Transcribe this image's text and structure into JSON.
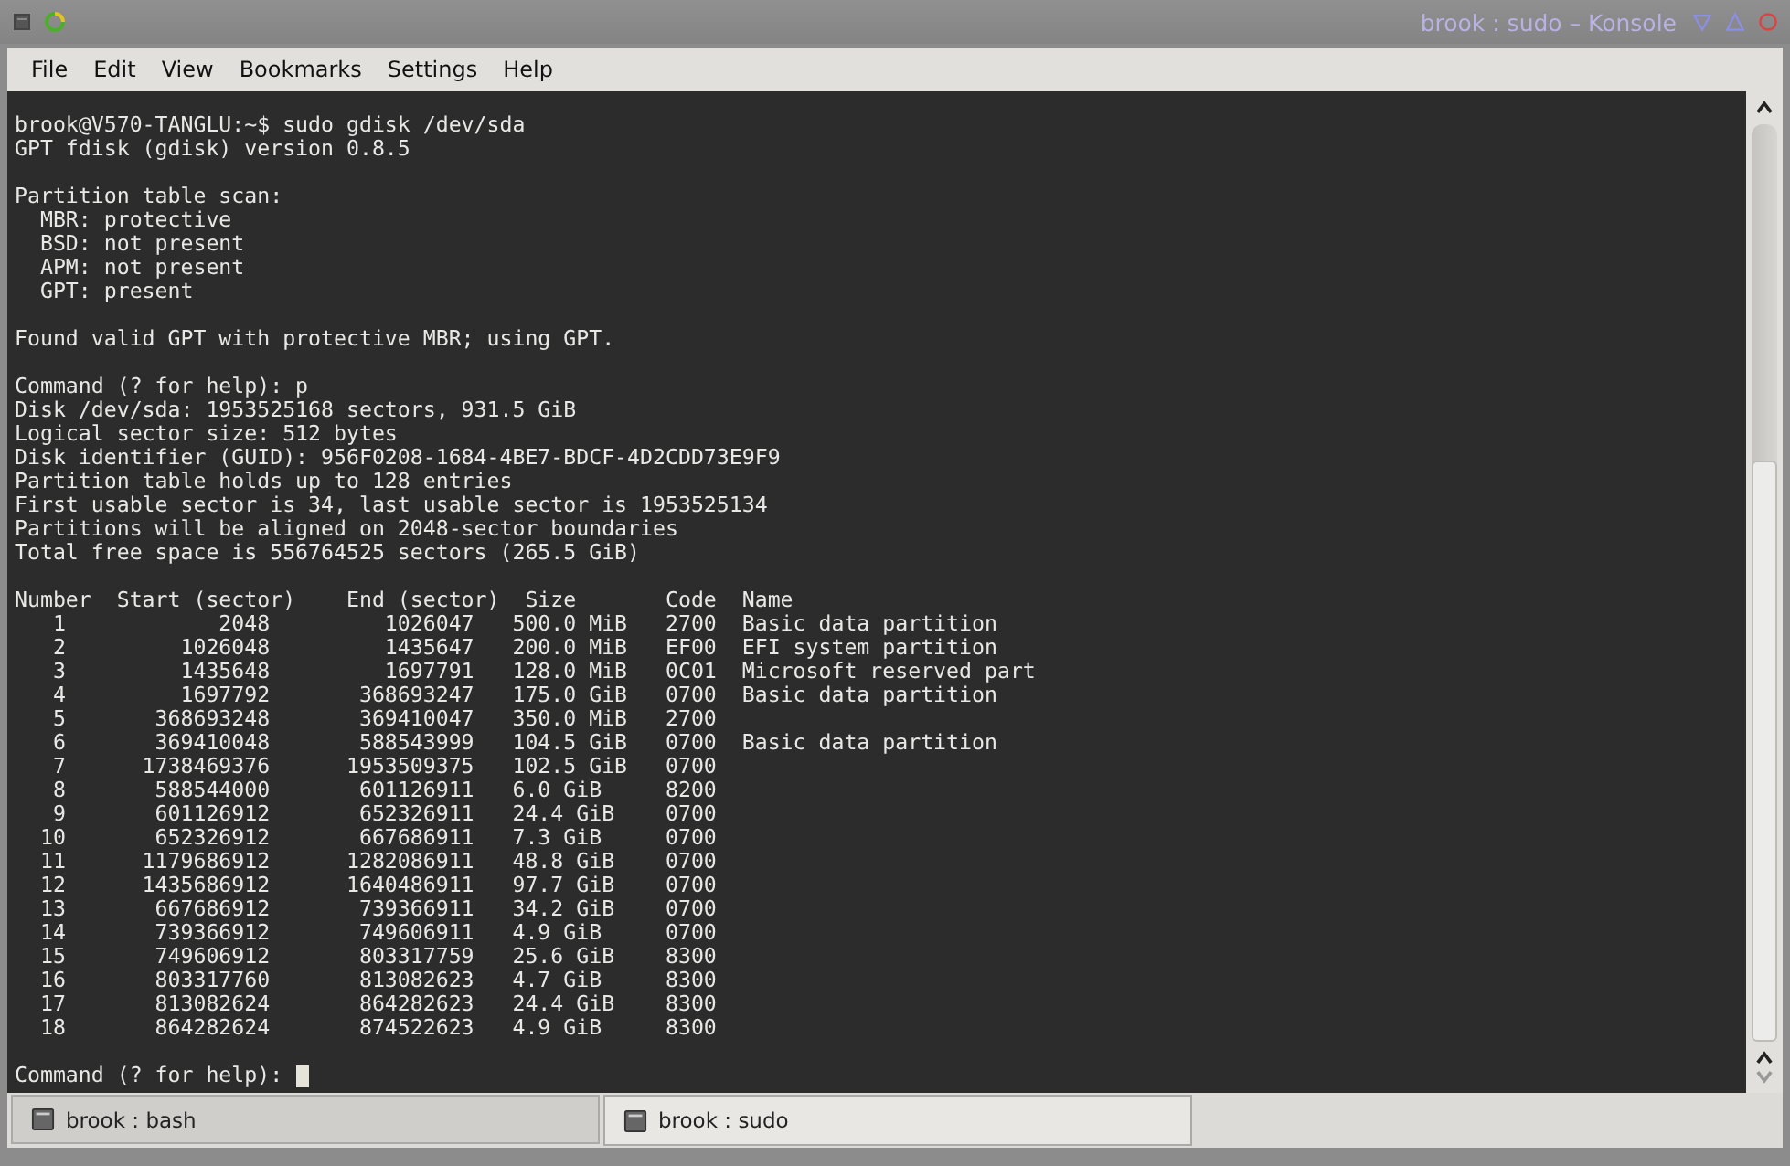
{
  "window": {
    "title": "brook : sudo – Konsole"
  },
  "menu": [
    "File",
    "Edit",
    "View",
    "Bookmarks",
    "Settings",
    "Help"
  ],
  "terminal": {
    "blocks": [
      [
        "brook@V570-TANGLU:~$ sudo gdisk /dev/sda",
        "GPT fdisk (gdisk) version 0.8.5"
      ],
      [
        "Partition table scan:",
        "  MBR: protective",
        "  BSD: not present",
        "  APM: not present",
        "  GPT: present"
      ],
      [
        "Found valid GPT with protective MBR; using GPT."
      ],
      [
        "Command (? for help): p",
        "Disk /dev/sda: 1953525168 sectors, 931.5 GiB",
        "Logical sector size: 512 bytes",
        "Disk identifier (GUID): 956F0208-1684-4BE7-BDCF-4D2CDD73E9F9",
        "Partition table holds up to 128 entries",
        "First usable sector is 34, last usable sector is 1953525134",
        "Partitions will be aligned on 2048-sector boundaries",
        "Total free space is 556764525 sectors (265.5 GiB)"
      ],
      [
        "Number  Start (sector)    End (sector)  Size       Code  Name",
        "   1            2048         1026047   500.0 MiB   2700  Basic data partition",
        "   2         1026048         1435647   200.0 MiB   EF00  EFI system partition",
        "   3         1435648         1697791   128.0 MiB   0C01  Microsoft reserved part",
        "   4         1697792       368693247   175.0 GiB   0700  Basic data partition",
        "   5       368693248       369410047   350.0 MiB   2700",
        "   6       369410048       588543999   104.5 GiB   0700  Basic data partition",
        "   7      1738469376      1953509375   102.5 GiB   0700",
        "   8       588544000       601126911   6.0 GiB     8200",
        "   9       601126912       652326911   24.4 GiB    0700",
        "  10       652326912       667686911   7.3 GiB     0700",
        "  11      1179686912      1282086911   48.8 GiB    0700",
        "  12      1435686912      1640486911   97.7 GiB    0700",
        "  13       667686912       739366911   34.2 GiB    0700",
        "  14       739366912       749606911   4.9 GiB     0700",
        "  15       749606912       803317759   25.6 GiB    8300",
        "  16       803317760       813082623   4.7 GiB     8300",
        "  17       813082624       864282623   24.4 GiB    8300",
        "  18       864282624       874522623   4.9 GiB     8300"
      ]
    ],
    "prompt": "Command (? for help):"
  },
  "tabs": [
    {
      "label": "brook : bash",
      "selected": false
    },
    {
      "label": "brook : sudo",
      "selected": true
    }
  ]
}
